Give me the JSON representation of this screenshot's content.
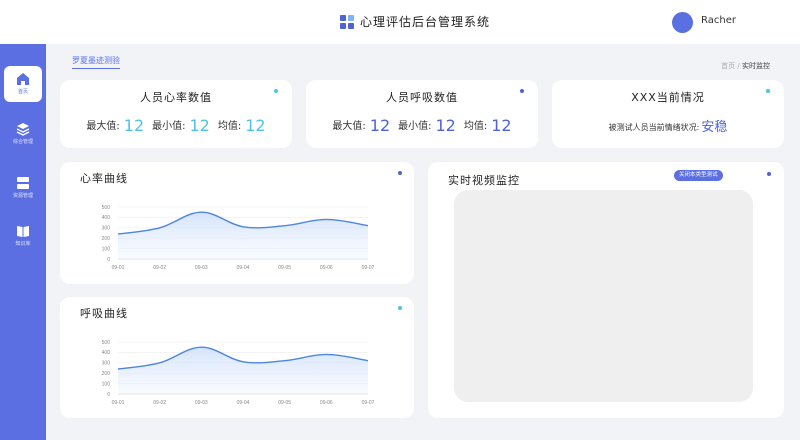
{
  "header": {
    "title": "心理评估后台管理系统",
    "user": "Racher",
    "logo_colors": [
      "#4d63d6",
      "#7fb4f5",
      "#4d63d6",
      "#4d63d6"
    ]
  },
  "sidebar": {
    "items": [
      {
        "label": "首页",
        "icon": "home-icon",
        "active": true
      },
      {
        "label": "综合管理",
        "icon": "layers-icon",
        "active": false
      },
      {
        "label": "资源管理",
        "icon": "storage-icon",
        "active": false
      },
      {
        "label": "知识库",
        "icon": "book-icon",
        "active": false
      }
    ]
  },
  "subtab": "罗夏墨迹测验",
  "breadcrumb": {
    "home": "首页",
    "sep": "/",
    "current": "实时监控"
  },
  "heart_stats": {
    "title": "人员心率数值",
    "max_label": "最大值:",
    "max": "12",
    "min_label": "最小值:",
    "min": "12",
    "avg_label": "均值:",
    "avg": "12"
  },
  "breath_stats": {
    "title": "人员呼吸数值",
    "max_label": "最大值:",
    "max": "12",
    "min_label": "最小值:",
    "min": "12",
    "avg_label": "均值:",
    "avg": "12"
  },
  "status": {
    "title": "XXX当前情况",
    "label": "被测试人员当前情绪状况:",
    "value": "安稳"
  },
  "video": {
    "title": "实时视频监控",
    "button": "关闭本类型测试"
  },
  "colors": {
    "accent": "#5b6fe3",
    "cyan": "#4fc3e6",
    "line": "#4d86e0"
  },
  "chart_data": [
    {
      "type": "area",
      "title": "心率曲线",
      "categories": [
        "09-01",
        "09-02",
        "09-03",
        "09-04",
        "09-05",
        "09-06",
        "09-07"
      ],
      "values": [
        240,
        300,
        450,
        310,
        320,
        380,
        320
      ],
      "yticks": [
        0,
        100,
        200,
        300,
        400,
        500
      ],
      "ylim": [
        0,
        500
      ],
      "grid": true
    },
    {
      "type": "area",
      "title": "呼吸曲线",
      "categories": [
        "09-01",
        "09-02",
        "09-03",
        "09-04",
        "09-05",
        "09-06",
        "09-07"
      ],
      "values": [
        240,
        300,
        450,
        310,
        320,
        380,
        320
      ],
      "yticks": [
        0,
        100,
        200,
        300,
        400,
        500
      ],
      "ylim": [
        0,
        500
      ],
      "grid": true
    }
  ]
}
